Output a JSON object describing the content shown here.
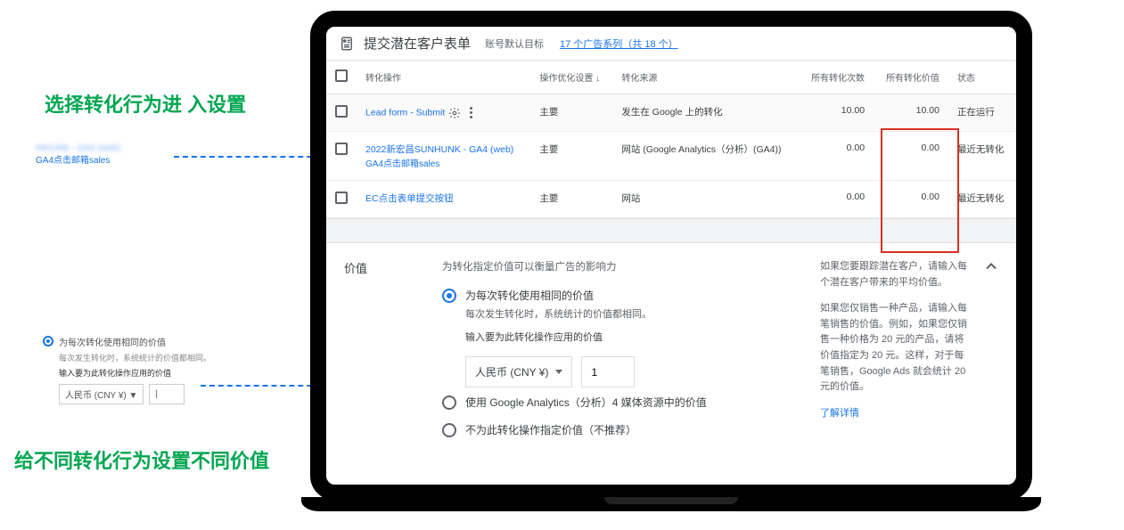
{
  "annotations": {
    "top": "选择转化行为进 入设置",
    "bottom": "给不同转化行为设置不同价值"
  },
  "sideThumb1": {
    "line1blur": "INHUNK - GA4 (web)",
    "line2": "GA4点击邮箱sales"
  },
  "sideThumb2": {
    "radioLabel": "为每次转化使用相同的价值",
    "sub1": "每次发生转化时，系统统计的价值都相同。",
    "sub2": "输入要为此转化操作应用的价值",
    "currency": "人民币 (CNY ¥) ▼",
    "val": "|"
  },
  "header": {
    "title": "提交潜在客户表单",
    "sub": "账号默认目标",
    "link": "17 个广告系列（共 18 个）"
  },
  "table": {
    "cols": {
      "c1": "转化操作",
      "c2": "操作优化设置",
      "c3": "转化来源",
      "c4": "所有转化次数",
      "c5": "所有转化价值",
      "c6": "状态"
    },
    "rows": [
      {
        "name": "Lead form - Submit",
        "setting": "主要",
        "source": "发生在 Google 上的转化",
        "count": "10.00",
        "value": "10.00",
        "status": "正在运行",
        "statusClass": "ok",
        "gear": true
      },
      {
        "name": "2022新宏昌SUNHUNK - GA4 (web)",
        "name2": "GA4点击邮箱sales",
        "setting": "主要",
        "source": "网站 (Google Analytics（分析）(GA4))",
        "count": "0.00",
        "value": "0.00",
        "status": "最近无转化",
        "statusClass": "no"
      },
      {
        "name": "EC点击表单提交按钮",
        "setting": "主要",
        "source": "网站",
        "count": "0.00",
        "value": "0.00",
        "status": "最近无转化",
        "statusClass": "no"
      }
    ]
  },
  "valueSection": {
    "title": "价值",
    "desc": "为转化指定价值可以衡量广告的影响力",
    "opt1": {
      "label": "为每次转化使用相同的价值",
      "sub": "每次发生转化时，系统统计的价值都相同。",
      "inputLabel": "输入要为此转化操作应用的价值",
      "currency": "人民币 (CNY ¥)",
      "val": "1"
    },
    "opt2": {
      "label": "使用 Google Analytics（分析）4 媒体资源中的价值"
    },
    "opt3": {
      "label": "不为此转化操作指定价值（不推荐）"
    },
    "help": {
      "p1": "如果您要跟踪潜在客户，请输入每个潜在客户带来的平均价值。",
      "p2": "如果您仅销售一种产品，请输入每笔销售的价值。例如，如果您仅销售一种价格为 20 元的产品，请将价值指定为 20 元。这样，对于每笔销售，Google Ads 就会统计 20 元的价值。",
      "learn": "了解详情"
    }
  }
}
